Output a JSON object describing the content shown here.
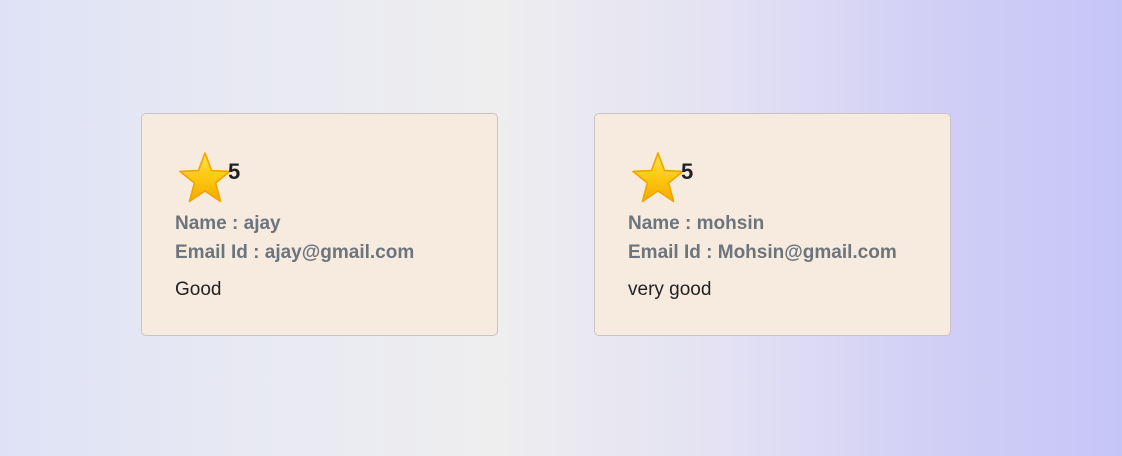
{
  "colors": {
    "card_background": "#f7ebe0",
    "star_gold": "#fcc30c",
    "label_gray": "#6c747c"
  },
  "reviews": [
    {
      "star_icon": "star-icon",
      "rating": "5",
      "name_label": "Name : ",
      "name": "ajay",
      "email_label": "Email Id : ",
      "email": "ajay@gmail.com",
      "comment": "Good"
    },
    {
      "star_icon": "star-icon",
      "rating": "5",
      "name_label": "Name : ",
      "name": "mohsin",
      "email_label": "Email Id : ",
      "email": "Mohsin@gmail.com",
      "comment": "very good"
    }
  ]
}
